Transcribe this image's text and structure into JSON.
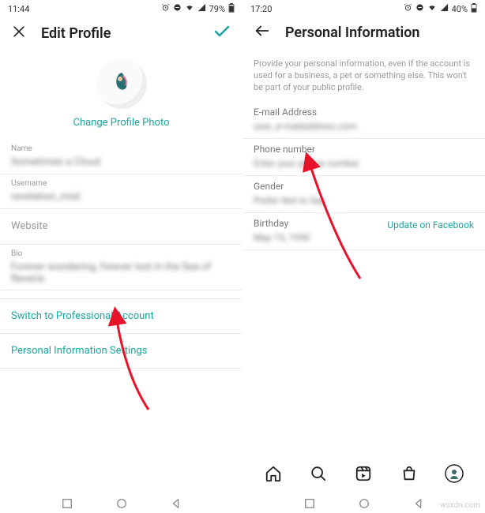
{
  "left": {
    "status": {
      "time": "11:44",
      "battery": "79%"
    },
    "header": {
      "title": "Edit Profile"
    },
    "change_photo": "Change Profile Photo",
    "fields": {
      "name": {
        "label": "Name",
        "value": "Sometimes a Cloud"
      },
      "username": {
        "label": "Username",
        "value": "revelation_mist"
      },
      "website": {
        "label": "Website",
        "value": ""
      },
      "bio": {
        "label": "Bio",
        "value": "Forever wondering, forever lost in the Sea of Reverie"
      }
    },
    "links": {
      "switch_pro": "Switch to Professional Account",
      "personal_info": "Personal Information Settings"
    }
  },
  "right": {
    "status": {
      "time": "17:20",
      "battery": "40%"
    },
    "header": {
      "title": "Personal Information"
    },
    "description": "Provide your personal information, even if the account is used for a business, a pet or something else. This won't be part of your public profile.",
    "fields": {
      "email": {
        "label": "E-mail Address",
        "value": "user_e-mailaddress.com"
      },
      "phone": {
        "label": "Phone number",
        "value": "Enter your phone number"
      },
      "gender": {
        "label": "Gender",
        "value": "Prefer Not to Say"
      },
      "birthday": {
        "label": "Birthday",
        "value": "May 15, 1990"
      }
    },
    "update_fb": "Update on Facebook"
  },
  "watermark": "wsxdn.com"
}
